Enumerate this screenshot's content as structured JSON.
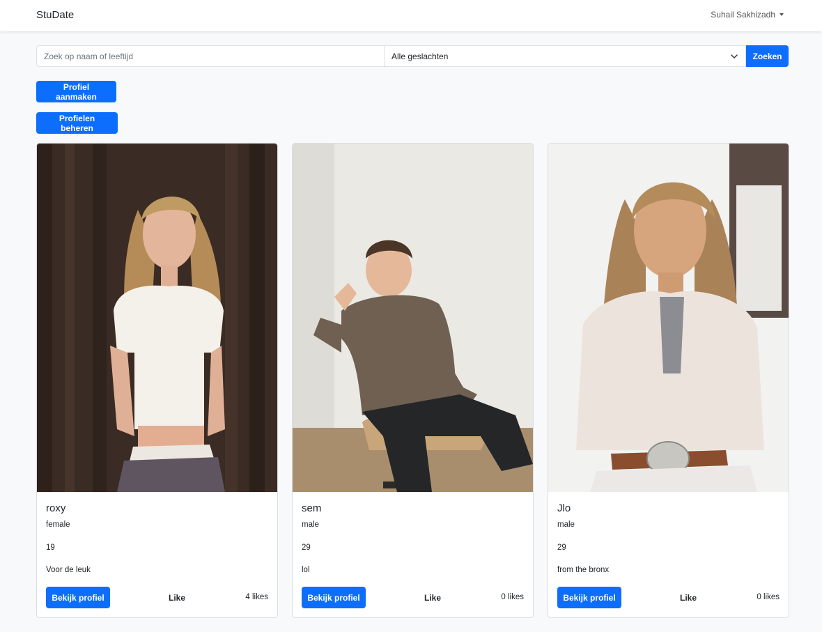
{
  "navbar": {
    "brand": "StuDate",
    "user_name": "Suhail Sakhizadh"
  },
  "search": {
    "placeholder": "Zoek op naam of leeftijd",
    "value": "",
    "gender_selected": "Alle geslachten",
    "submit_label": "Zoeken"
  },
  "actions": {
    "create_label": "Profiel aanmaken",
    "manage_label": "Profielen beheren"
  },
  "profiles": [
    {
      "name": "roxy",
      "gender": "female",
      "age": "19",
      "bio": "Voor de leuk",
      "view_label": "Bekijk profiel",
      "like_label": "Like",
      "likes": "4 likes"
    },
    {
      "name": "sem",
      "gender": "male",
      "age": "29",
      "bio": "lol",
      "view_label": "Bekijk profiel",
      "like_label": "Like",
      "likes": "0 likes"
    },
    {
      "name": "Jlo",
      "gender": "male",
      "age": "29",
      "bio": "from the bronx",
      "view_label": "Bekijk profiel",
      "like_label": "Like",
      "likes": "0 likes"
    }
  ],
  "colors": {
    "primary": "#0d6efd",
    "page_bg": "#f8f9fa"
  }
}
